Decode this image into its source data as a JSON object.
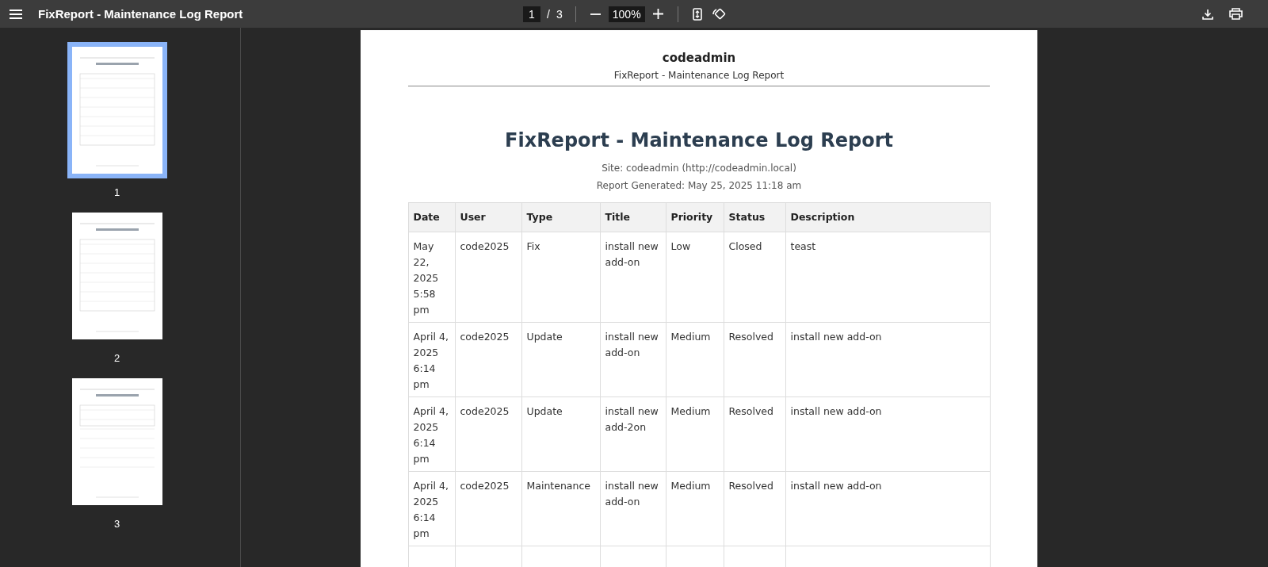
{
  "toolbar": {
    "title": "FixReport - Maintenance Log Report",
    "page_number": "1",
    "page_separator": "/",
    "page_count": "3",
    "zoom": "100%"
  },
  "thumbnails": [
    {
      "label": "1",
      "selected": true
    },
    {
      "label": "2",
      "selected": false
    },
    {
      "label": "3",
      "selected": false
    }
  ],
  "page": {
    "header_title": "codeadmin",
    "header_subtitle": "FixReport - Maintenance Log Report",
    "title": "FixReport - Maintenance Log Report",
    "site": "Site: codeadmin (http://codeadmin.local)",
    "generated": "Report Generated: May 25, 2025 11:18 am",
    "table": {
      "columns": [
        "Date",
        "User",
        "Type",
        "Title",
        "Priority",
        "Status",
        "Description"
      ],
      "rows": [
        [
          "May 22, 2025 5:58 pm",
          "code2025",
          "Fix",
          "install new add-on",
          "Low",
          "Closed",
          "teast"
        ],
        [
          "April 4, 2025 6:14 pm",
          "code2025",
          "Update",
          "install new add-on",
          "Medium",
          "Resolved",
          "install new add-on"
        ],
        [
          "April 4, 2025 6:14 pm",
          "code2025",
          "Update",
          "install new add-2on",
          "Medium",
          "Resolved",
          "install new add-on"
        ],
        [
          "April 4, 2025 6:14 pm",
          "code2025",
          "Maintenance",
          "install new add-on",
          "Medium",
          "Resolved",
          "install new add-on"
        ]
      ]
    }
  }
}
